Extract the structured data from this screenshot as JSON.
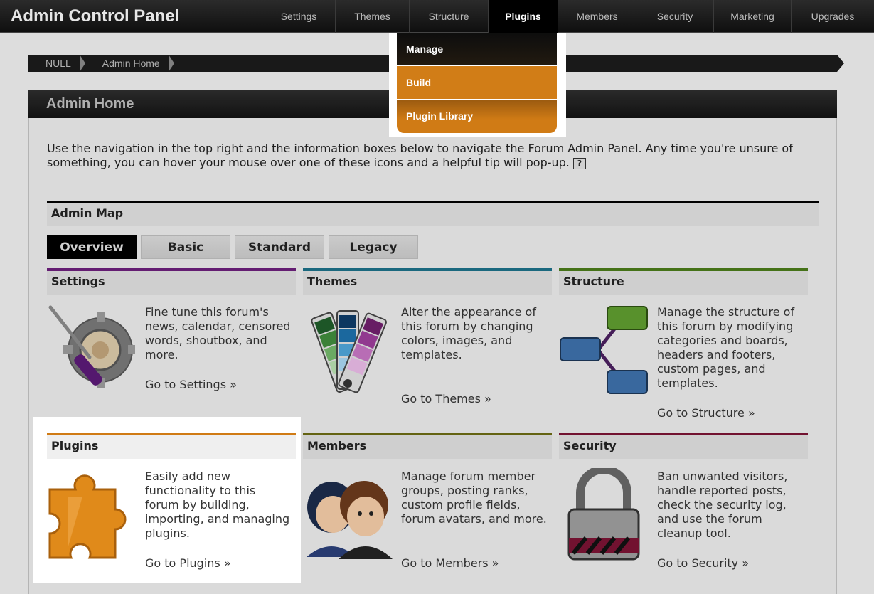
{
  "app": {
    "title": "Admin Control Panel"
  },
  "nav": {
    "tabs": [
      {
        "label": "Settings"
      },
      {
        "label": "Themes"
      },
      {
        "label": "Structure"
      },
      {
        "label": "Plugins"
      },
      {
        "label": "Members"
      },
      {
        "label": "Security"
      },
      {
        "label": "Marketing"
      },
      {
        "label": "Upgrades"
      }
    ],
    "active": "Plugins"
  },
  "plugins_menu": {
    "items": [
      {
        "label": "Manage"
      },
      {
        "label": "Build"
      },
      {
        "label": "Plugin Library"
      }
    ],
    "highlighted": "Build"
  },
  "breadcrumb": [
    "NULL",
    "Admin Home"
  ],
  "page": {
    "title": "Admin Home",
    "intro": "Use the navigation in the top right and the information boxes below to navigate the Forum Admin Panel. Any time you're unsure of something, you can hover your mouse over one of these icons and a helpful tip will pop-up.",
    "help_icon_glyph": "?"
  },
  "admin_map": {
    "title": "Admin Map",
    "views": [
      {
        "label": "Overview"
      },
      {
        "label": "Basic"
      },
      {
        "label": "Standard"
      },
      {
        "label": "Legacy"
      }
    ],
    "active_view": "Overview"
  },
  "cards": {
    "settings": {
      "title": "Settings",
      "desc": "Fine tune this forum's news, calendar, censored words, shoutbox, and more.",
      "link": "Go to Settings »",
      "accent": "#6b1f7a",
      "icon": "gear-screwdriver-icon"
    },
    "themes": {
      "title": "Themes",
      "desc": "Alter the appearance of this forum by changing colors, images, and templates.",
      "link": "Go to Themes »",
      "accent": "#1c6f86",
      "icon": "color-swatch-icon"
    },
    "structure": {
      "title": "Structure",
      "desc": "Manage the structure of this forum by modifying categories and boards, headers and footers, custom pages, and templates.",
      "link": "Go to Structure »",
      "accent": "#4a7a1a",
      "icon": "hierarchy-icon"
    },
    "plugins": {
      "title": "Plugins",
      "desc": "Easily add new functionality to this forum by building, importing, and managing plugins.",
      "link": "Go to Plugins »",
      "accent": "#d07b15",
      "icon": "puzzle-piece-icon"
    },
    "members": {
      "title": "Members",
      "desc": "Manage forum member groups, posting ranks, custom profile fields, forum avatars, and more.",
      "link": "Go to Members »",
      "accent": "#6b6a14",
      "icon": "members-icon"
    },
    "security": {
      "title": "Security",
      "desc": "Ban unwanted visitors, handle reported posts, check the security log, and use the forum cleanup tool.",
      "link": "Go to Security »",
      "accent": "#7a1434",
      "icon": "padlock-icon"
    }
  }
}
